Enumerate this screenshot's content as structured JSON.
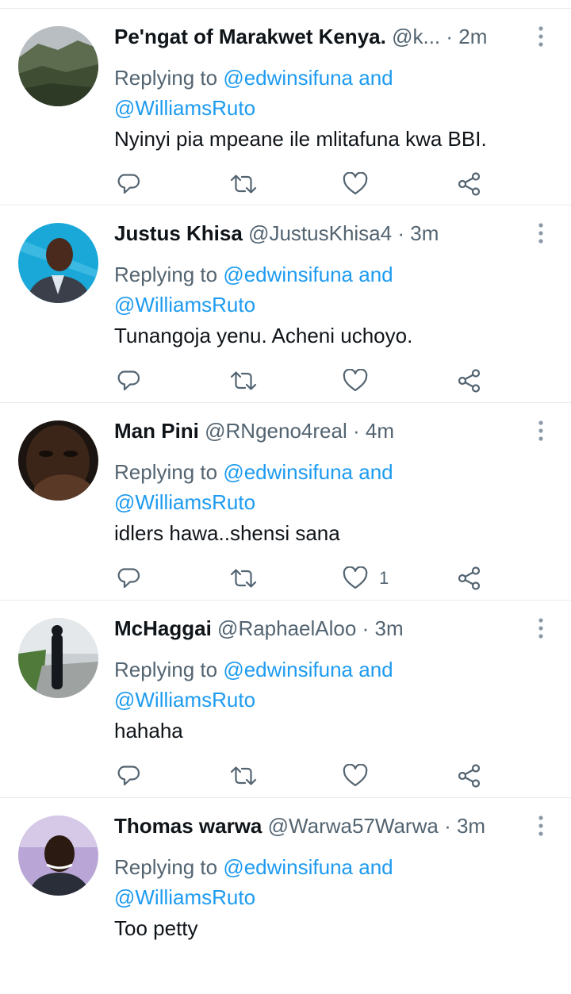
{
  "tweets": [
    {
      "name": "Pe'ngat of Marakwet Kenya.",
      "handle": "@k...",
      "separator": "·",
      "time": "2m",
      "replying_prefix": "Replying to",
      "mention1": "@edwinsifuna",
      "mention_joiner": "and",
      "mention2": "@WilliamsRuto",
      "text": "Nyinyi pia mpeane ile mlitafuna kwa BBI.",
      "like_count": ""
    },
    {
      "name": "Justus Khisa",
      "handle": "@JustusKhisa4",
      "separator": "·",
      "time": "3m",
      "replying_prefix": "Replying to",
      "mention1": "@edwinsifuna",
      "mention_joiner": "and",
      "mention2": "@WilliamsRuto",
      "text": "Tunangoja yenu. Acheni uchoyo.",
      "like_count": ""
    },
    {
      "name": "Man Pini",
      "handle": "@RNgeno4real",
      "separator": "·",
      "time": "4m",
      "replying_prefix": "Replying to",
      "mention1": "@edwinsifuna",
      "mention_joiner": "and",
      "mention2": "@WilliamsRuto",
      "text": "idlers hawa..shensi sana",
      "like_count": "1"
    },
    {
      "name": "McHaggai",
      "handle": "@RaphaelAloo",
      "separator": "·",
      "time": "3m",
      "replying_prefix": "Replying to",
      "mention1": "@edwinsifuna",
      "mention_joiner": "and",
      "mention2": "@WilliamsRuto",
      "text": "hahaha",
      "like_count": ""
    },
    {
      "name": "Thomas warwa",
      "handle": "@Warwa57Warwa",
      "separator": "·",
      "time": "3m",
      "replying_prefix": "Replying to",
      "mention1": "@edwinsifuna",
      "mention_joiner": "and",
      "mention2": "@WilliamsRuto",
      "text": "Too petty",
      "like_count": ""
    }
  ],
  "icons": {
    "reply": "reply-icon",
    "retweet": "retweet-icon",
    "like": "heart-icon",
    "share": "share-icon",
    "more": "more-vertical-icon"
  },
  "colors": {
    "mention": "#1d9bf0",
    "secondary_text": "#536471",
    "primary_text": "#0f1419",
    "divider": "#e6ecf0"
  }
}
